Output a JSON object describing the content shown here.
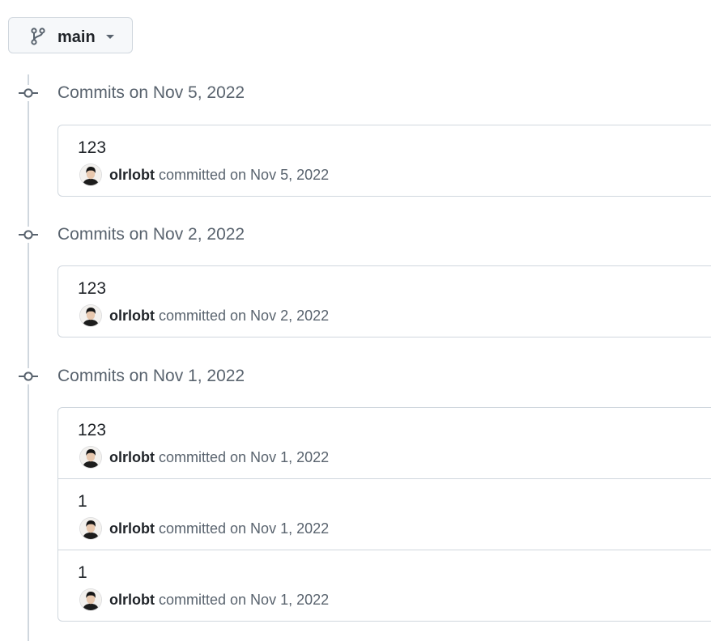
{
  "branch": {
    "label": "main",
    "icon": "git-branch-icon"
  },
  "groups": [
    {
      "title": "Commits on Nov 5, 2022",
      "commits": [
        {
          "message": "123",
          "author": "olrlobt",
          "action": "committed on Nov 5, 2022"
        }
      ]
    },
    {
      "title": "Commits on Nov 2, 2022",
      "commits": [
        {
          "message": "123",
          "author": "olrlobt",
          "action": "committed on Nov 2, 2022"
        }
      ]
    },
    {
      "title": "Commits on Nov 1, 2022",
      "commits": [
        {
          "message": "123",
          "author": "olrlobt",
          "action": "committed on Nov 1, 2022"
        },
        {
          "message": "1",
          "author": "olrlobt",
          "action": "committed on Nov 1, 2022"
        },
        {
          "message": "1",
          "author": "olrlobt",
          "action": "committed on Nov 1, 2022"
        }
      ]
    }
  ],
  "colors": {
    "border": "#d0d7de",
    "muted_text": "#59636e",
    "text": "#1f2328",
    "button_bg": "#f6f8fa"
  }
}
